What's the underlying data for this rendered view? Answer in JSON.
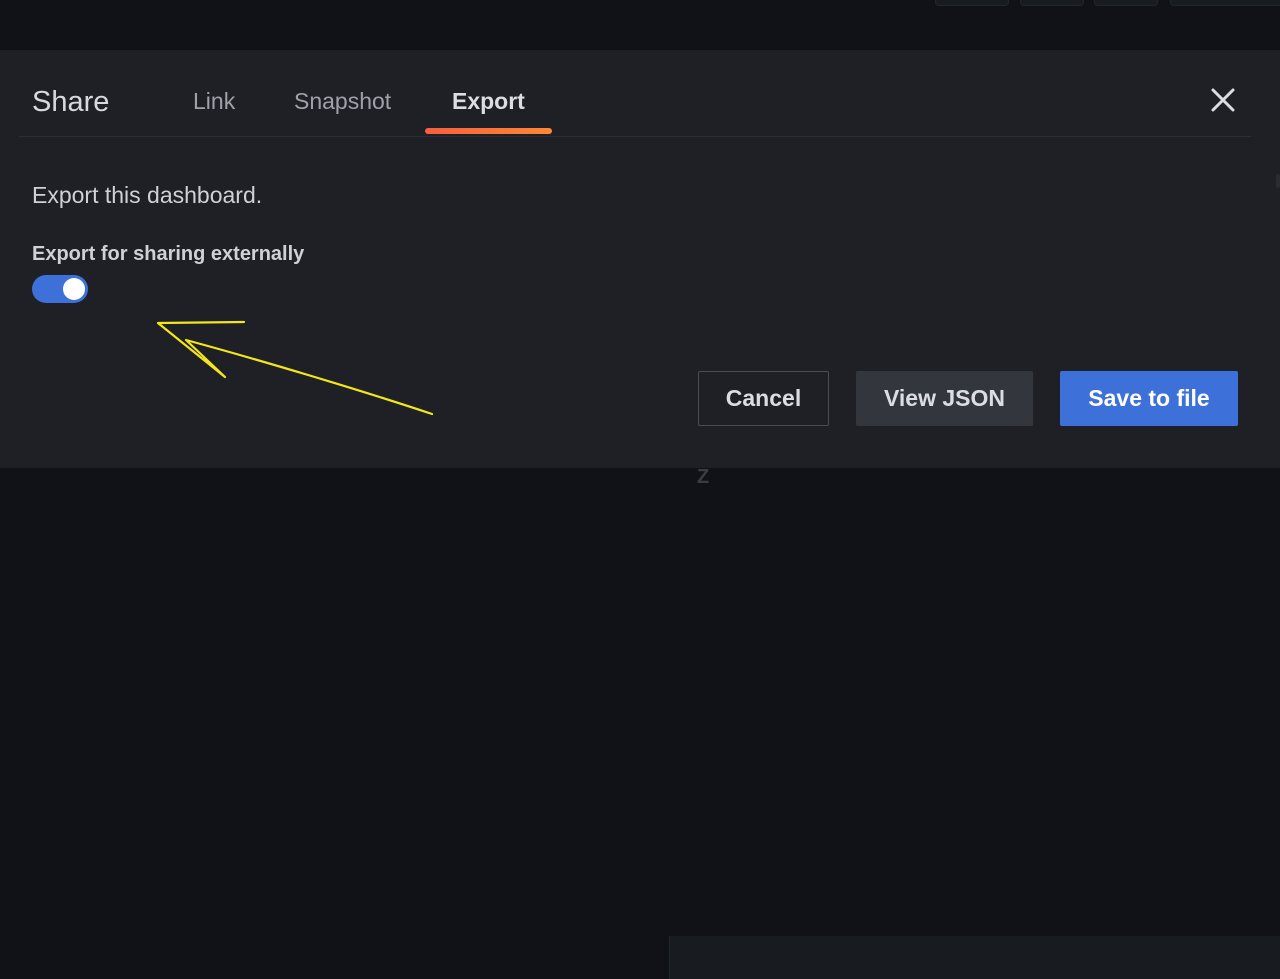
{
  "modal": {
    "title": "Share",
    "tabs": [
      {
        "label": "Link",
        "active": false
      },
      {
        "label": "Snapshot",
        "active": false
      },
      {
        "label": "Export",
        "active": true
      }
    ],
    "close_icon": "close-icon",
    "description": "Export this dashboard.",
    "share_externally": {
      "label": "Export for sharing externally",
      "enabled": true
    },
    "buttons": {
      "cancel": "Cancel",
      "view_json": "View JSON",
      "save": "Save to file"
    }
  },
  "backdrop": {
    "glyph": "Z"
  },
  "colors": {
    "modal_bg": "#1f2025",
    "page_bg": "#111217",
    "primary": "#3d71d9",
    "tab_accent": "#ff7a33",
    "annotation": "#f2e61c"
  }
}
